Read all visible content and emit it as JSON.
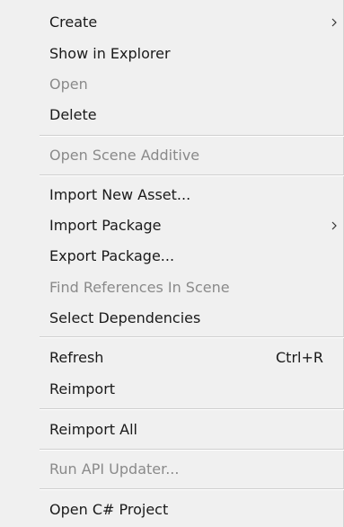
{
  "menu": {
    "items": [
      {
        "label": "Create",
        "enabled": true,
        "submenu": true,
        "icon": "chevron-right-icon"
      },
      {
        "label": "Show in Explorer",
        "enabled": true
      },
      {
        "label": "Open",
        "enabled": false
      },
      {
        "label": "Delete",
        "enabled": true
      },
      {
        "label": "Open Scene Additive",
        "enabled": false
      },
      {
        "label": "Import New Asset...",
        "enabled": true
      },
      {
        "label": "Import Package",
        "enabled": true,
        "submenu": true,
        "icon": "chevron-right-icon"
      },
      {
        "label": "Export Package...",
        "enabled": true
      },
      {
        "label": "Find References In Scene",
        "enabled": false
      },
      {
        "label": "Select Dependencies",
        "enabled": true
      },
      {
        "label": "Refresh",
        "enabled": true,
        "shortcut": "Ctrl+R"
      },
      {
        "label": "Reimport",
        "enabled": true
      },
      {
        "label": "Reimport All",
        "enabled": true
      },
      {
        "label": "Run API Updater...",
        "enabled": false
      },
      {
        "label": "Open C# Project",
        "enabled": true
      }
    ]
  },
  "colors": {
    "background": "#f0f0f0",
    "text": "#1a1a1a",
    "disabled_text": "#8a8a8a",
    "separator": "#cfcfcf"
  }
}
